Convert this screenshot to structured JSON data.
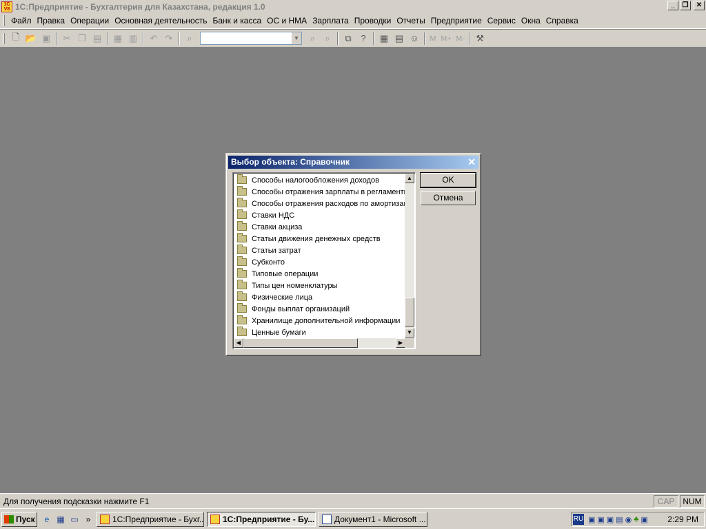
{
  "window": {
    "title": "1С:Предприятие - Бухгалтерия для Казахстана, редакция 1.0",
    "app_icon": "1C"
  },
  "menu": [
    "Файл",
    "Правка",
    "Операции",
    "Основная деятельность",
    "Банк и касса",
    "ОС и НМА",
    "Зарплата",
    "Проводки",
    "Отчеты",
    "Предприятие",
    "Сервис",
    "Окна",
    "Справка"
  ],
  "toolbar": {
    "combo_value": "",
    "mem_labels": [
      "M",
      "M+",
      "M-"
    ]
  },
  "dialog": {
    "title": "Выбор объекта: Справочник",
    "items": [
      "Способы налогообложения доходов",
      "Способы отражения зарплаты в регламенти",
      "Способы отражения расходов по амортизац",
      "Ставки НДС",
      "Ставки акциза",
      "Статьи движения денежных средств",
      "Статьи затрат",
      "Субконто",
      "Типовые операции",
      "Типы цен номенклатуры",
      "Физические лица",
      "Фонды выплат организаций",
      "Хранилище дополнительной информации",
      "Ценные бумаги"
    ],
    "ok_label": "OK",
    "cancel_label": "Отмена"
  },
  "status": {
    "hint": "Для получения подсказки нажмите F1",
    "cap": "CAP",
    "num": "NUM"
  },
  "taskbar": {
    "start_label": "Пуск",
    "tasks": [
      "1С:Предприятие - Бухг...",
      "1С:Предприятие - Бу...",
      "Документ1 - Microsoft ..."
    ],
    "lang": "RU",
    "clock": "2:29 PM"
  }
}
